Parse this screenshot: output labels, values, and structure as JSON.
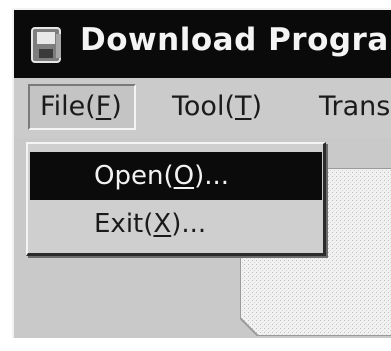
{
  "window": {
    "title": "Download Program",
    "icon": "disk-app-icon"
  },
  "menubar": {
    "file": {
      "label": "File(",
      "mnemonic": "F",
      "suffix": ")"
    },
    "tool": {
      "label": "Tool(",
      "mnemonic": "T",
      "suffix": ")"
    },
    "trans": {
      "label": "Trans"
    }
  },
  "file_menu": {
    "open": {
      "label": "Open(",
      "mnemonic": "O",
      "suffix": ")..."
    },
    "exit": {
      "label": "Exit(",
      "mnemonic": "X",
      "suffix": ")..."
    }
  },
  "colors": {
    "titlebar": "#0a0a0a",
    "menu_bg": "#cbcbcb",
    "highlight": "#0b0b0b"
  }
}
